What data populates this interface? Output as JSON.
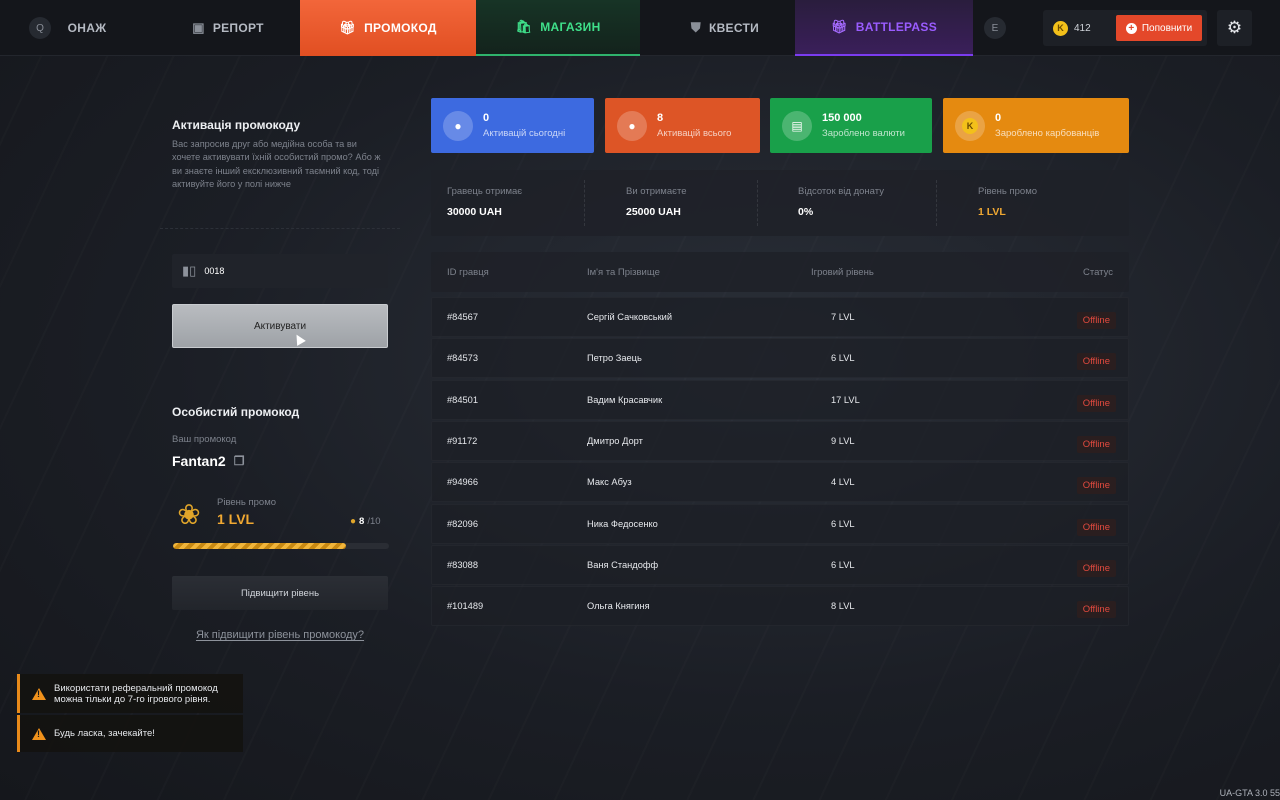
{
  "nav": {
    "key_left": "Q",
    "key_right": "E",
    "items": [
      {
        "label": "ОНАЖ",
        "icon": "person-icon"
      },
      {
        "label": "РЕПОРТ",
        "icon": "chat-icon"
      },
      {
        "label": "ПРОМОКОД",
        "icon": "gift-icon"
      },
      {
        "label": "МАГАЗИН",
        "icon": "bag-icon"
      },
      {
        "label": "КВЕСТИ",
        "icon": "trophy-icon"
      },
      {
        "label": "BATTLEPASS",
        "icon": "gift-icon"
      }
    ],
    "balance": "412",
    "coin_letter": "K",
    "topup_label": "Поповнити"
  },
  "activation": {
    "title": "Активація промокоду",
    "description": "Вас запросив друг або медійна особа та ви хочете активувати їхній особистий промо? Або ж ви знаєте інший ексклюзивний таємний код, тоді активуйте його у полі нижче",
    "input_value": "0018",
    "button_label": "Активувати"
  },
  "personal": {
    "title": "Особистий промокод",
    "code_label": "Ваш промокод",
    "code": "Fantan2",
    "level_label": "Рівень промо",
    "level": "1 LVL",
    "activations": "8",
    "activations_max": "/10",
    "progress_fraction": 0.8,
    "upgrade_label": "Підвищити рівень",
    "how_link": "Як підвищити рівень промокоду?"
  },
  "stats": [
    {
      "value": "0",
      "label": "Активацій сьогодні",
      "color": "#3d6ae0",
      "icon": "user-icon"
    },
    {
      "value": "8",
      "label": "Активацій всього",
      "color": "#dd5526",
      "icon": "user-add-icon"
    },
    {
      "value": "150 000",
      "label": "Зароблено валюти",
      "color": "#19a04a",
      "icon": "money-icon"
    },
    {
      "value": "0",
      "label": "Зароблено карбованців",
      "color": "#e58a10",
      "icon": "coin-icon"
    }
  ],
  "info": [
    {
      "label": "Гравець отримає",
      "value": "30000 UAH"
    },
    {
      "label": "Ви отримаєте",
      "value": "25000 UAH"
    },
    {
      "label": "Відсоток від донату",
      "value": "0%"
    },
    {
      "label": "Рівень промо",
      "value": "1 LVL"
    }
  ],
  "table": {
    "headers": [
      "ID гравця",
      "Ім'я та Прізвище",
      "Ігровий рівень",
      "Статус"
    ],
    "rows": [
      {
        "id": "#84567",
        "name": "Сергій Сачковський",
        "level": "7 LVL",
        "status": "Offline"
      },
      {
        "id": "#84573",
        "name": "Петро Заець",
        "level": "6 LVL",
        "status": "Offline"
      },
      {
        "id": "#84501",
        "name": "Вадим Красавчик",
        "level": "17 LVL",
        "status": "Offline"
      },
      {
        "id": "#91172",
        "name": "Дмитро Дорт",
        "level": "9 LVL",
        "status": "Offline"
      },
      {
        "id": "#94966",
        "name": "Макс Абуз",
        "level": "4 LVL",
        "status": "Offline"
      },
      {
        "id": "#82096",
        "name": "Ника Федосенко",
        "level": "6 LVL",
        "status": "Offline"
      },
      {
        "id": "#83088",
        "name": "Ваня Стандофф",
        "level": "6 LVL",
        "status": "Offline"
      },
      {
        "id": "#101489",
        "name": "Ольга Княгиня",
        "level": "8 LVL",
        "status": "Offline"
      }
    ]
  },
  "toasts": [
    {
      "text": "Використати реферальний промокод можна тільки до 7-го ігрового рівня."
    },
    {
      "text": "Будь ласка, зачекайте!"
    }
  ],
  "version": "UA-GTA 3.0   55"
}
